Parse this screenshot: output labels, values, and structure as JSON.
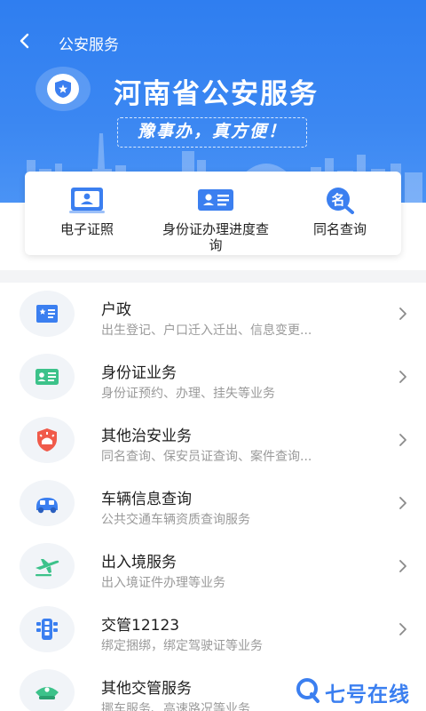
{
  "topbar": {
    "title": "公安服务"
  },
  "hero": {
    "title": "河南省公安服务",
    "slogan": "豫事办，真方便！"
  },
  "quick_actions": [
    {
      "label": "电子证照",
      "icon": "id-card-icon",
      "color": "#3b7ff0"
    },
    {
      "label": "身份证办理进度查询",
      "icon": "id-badge-icon",
      "color": "#3b7ff0"
    },
    {
      "label": "同名查询",
      "icon": "name-search-icon",
      "color": "#3b7ff0"
    }
  ],
  "services": [
    {
      "title": "户政",
      "subtitle": "出生登记、户口迁入迁出、信息变更...",
      "icon": "household-book-icon",
      "color": "#3b7ff0"
    },
    {
      "title": "身份证业务",
      "subtitle": "身份证预约、办理、挂失等业务",
      "icon": "id-card-green-icon",
      "color": "#3cc28a"
    },
    {
      "title": "其他治安业务",
      "subtitle": "同名查询、保安员证查询、案件查询...",
      "icon": "shield-alarm-icon",
      "color": "#f05a4a"
    },
    {
      "title": "车辆信息查询",
      "subtitle": "公共交通车辆资质查询服务",
      "icon": "vehicle-icon",
      "color": "#3b7ff0"
    },
    {
      "title": "出入境服务",
      "subtitle": "出入境证件办理等业务",
      "icon": "airplane-icon",
      "color": "#3cc28a"
    },
    {
      "title": "交管12123",
      "subtitle": "绑定捆绑，绑定驾驶证等业务",
      "icon": "traffic-light-icon",
      "color": "#3b7ff0"
    },
    {
      "title": "其他交管服务",
      "subtitle": "挪车服务、高速路况等业务",
      "icon": "police-hat-icon",
      "color": "#3cc28a"
    }
  ],
  "watermark": {
    "text": "七号在线"
  }
}
